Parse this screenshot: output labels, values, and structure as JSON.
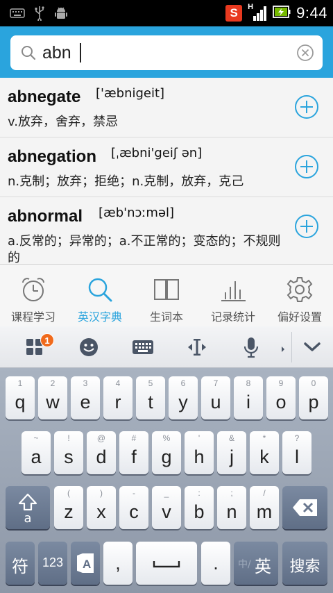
{
  "status_bar": {
    "time": "9:44",
    "network_type": "H",
    "icons": [
      "keyboard-icon",
      "usb-icon",
      "android-debug-icon",
      "sogou-ime-icon",
      "signal-icon",
      "battery-charging-icon"
    ],
    "sogou_letter": "S"
  },
  "search": {
    "value": "abn",
    "icons": [
      "search-icon",
      "clear-icon"
    ]
  },
  "results": [
    {
      "word": "abnegate",
      "phonetic": "['æbnigeit]",
      "definition": "v.放弃，舍弃，禁忌"
    },
    {
      "word": "abnegation",
      "phonetic": "[ˌæbni'geiʃ ən]",
      "definition": "n.克制；放弃；拒绝；n.克制，放弃，克己"
    },
    {
      "word": "abnormal",
      "phonetic": "[æb'nɔːməl]",
      "definition": "a.反常的；异常的；a.不正常的；变态的；不规则的"
    }
  ],
  "nav": {
    "active_color": "#2aa4dd",
    "items": [
      {
        "label": "课程学习",
        "icon": "alarm-clock-icon"
      },
      {
        "label": "英汉字典",
        "icon": "search-icon"
      },
      {
        "label": "生词本",
        "icon": "book-icon"
      },
      {
        "label": "记录统计",
        "icon": "bar-chart-icon"
      },
      {
        "label": "偏好设置",
        "icon": "gear-icon"
      }
    ]
  },
  "ime_toolbar": {
    "badge_count": "1",
    "icons": [
      "apps-icon",
      "emoji-icon",
      "keyboard-icon",
      "cursor-move-icon",
      "microphone-icon",
      "collapse-keyboard-icon"
    ]
  },
  "keyboard": {
    "row1": [
      {
        "hint": "1",
        "key": "q"
      },
      {
        "hint": "2",
        "key": "w"
      },
      {
        "hint": "3",
        "key": "e"
      },
      {
        "hint": "4",
        "key": "r"
      },
      {
        "hint": "5",
        "key": "t"
      },
      {
        "hint": "6",
        "key": "y"
      },
      {
        "hint": "7",
        "key": "u"
      },
      {
        "hint": "8",
        "key": "i"
      },
      {
        "hint": "9",
        "key": "o"
      },
      {
        "hint": "0",
        "key": "p"
      }
    ],
    "row2": [
      {
        "hint": "~",
        "key": "a"
      },
      {
        "hint": "!",
        "key": "s"
      },
      {
        "hint": "@",
        "key": "d"
      },
      {
        "hint": "#",
        "key": "f"
      },
      {
        "hint": "%",
        "key": "g"
      },
      {
        "hint": "'",
        "key": "h"
      },
      {
        "hint": "&",
        "key": "j"
      },
      {
        "hint": "*",
        "key": "k"
      },
      {
        "hint": "?",
        "key": "l"
      }
    ],
    "row3": [
      {
        "hint": "(",
        "key": "z"
      },
      {
        "hint": ")",
        "key": "x"
      },
      {
        "hint": "-",
        "key": "c"
      },
      {
        "hint": "_",
        "key": "v"
      },
      {
        "hint": ":",
        "key": "b"
      },
      {
        "hint": ";",
        "key": "n"
      },
      {
        "hint": "/",
        "key": "m"
      }
    ],
    "shift_sub": "a",
    "symbol": "符",
    "numbers": "123",
    "comma": ",",
    "period": ".",
    "lang_dim": "中/",
    "lang_active": "英",
    "search": "搜索"
  }
}
